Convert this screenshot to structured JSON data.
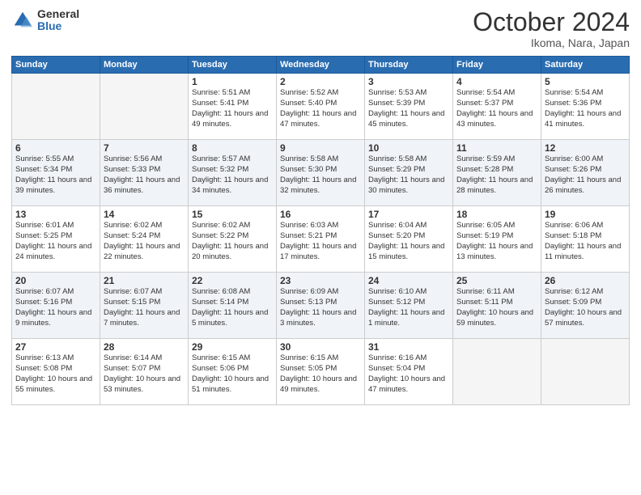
{
  "logo": {
    "general": "General",
    "blue": "Blue"
  },
  "title": "October 2024",
  "location": "Ikoma, Nara, Japan",
  "days_of_week": [
    "Sunday",
    "Monday",
    "Tuesday",
    "Wednesday",
    "Thursday",
    "Friday",
    "Saturday"
  ],
  "weeks": [
    [
      {
        "day": "",
        "info": ""
      },
      {
        "day": "",
        "info": ""
      },
      {
        "day": "1",
        "info": "Sunrise: 5:51 AM\nSunset: 5:41 PM\nDaylight: 11 hours and 49 minutes."
      },
      {
        "day": "2",
        "info": "Sunrise: 5:52 AM\nSunset: 5:40 PM\nDaylight: 11 hours and 47 minutes."
      },
      {
        "day": "3",
        "info": "Sunrise: 5:53 AM\nSunset: 5:39 PM\nDaylight: 11 hours and 45 minutes."
      },
      {
        "day": "4",
        "info": "Sunrise: 5:54 AM\nSunset: 5:37 PM\nDaylight: 11 hours and 43 minutes."
      },
      {
        "day": "5",
        "info": "Sunrise: 5:54 AM\nSunset: 5:36 PM\nDaylight: 11 hours and 41 minutes."
      }
    ],
    [
      {
        "day": "6",
        "info": "Sunrise: 5:55 AM\nSunset: 5:34 PM\nDaylight: 11 hours and 39 minutes."
      },
      {
        "day": "7",
        "info": "Sunrise: 5:56 AM\nSunset: 5:33 PM\nDaylight: 11 hours and 36 minutes."
      },
      {
        "day": "8",
        "info": "Sunrise: 5:57 AM\nSunset: 5:32 PM\nDaylight: 11 hours and 34 minutes."
      },
      {
        "day": "9",
        "info": "Sunrise: 5:58 AM\nSunset: 5:30 PM\nDaylight: 11 hours and 32 minutes."
      },
      {
        "day": "10",
        "info": "Sunrise: 5:58 AM\nSunset: 5:29 PM\nDaylight: 11 hours and 30 minutes."
      },
      {
        "day": "11",
        "info": "Sunrise: 5:59 AM\nSunset: 5:28 PM\nDaylight: 11 hours and 28 minutes."
      },
      {
        "day": "12",
        "info": "Sunrise: 6:00 AM\nSunset: 5:26 PM\nDaylight: 11 hours and 26 minutes."
      }
    ],
    [
      {
        "day": "13",
        "info": "Sunrise: 6:01 AM\nSunset: 5:25 PM\nDaylight: 11 hours and 24 minutes."
      },
      {
        "day": "14",
        "info": "Sunrise: 6:02 AM\nSunset: 5:24 PM\nDaylight: 11 hours and 22 minutes."
      },
      {
        "day": "15",
        "info": "Sunrise: 6:02 AM\nSunset: 5:22 PM\nDaylight: 11 hours and 20 minutes."
      },
      {
        "day": "16",
        "info": "Sunrise: 6:03 AM\nSunset: 5:21 PM\nDaylight: 11 hours and 17 minutes."
      },
      {
        "day": "17",
        "info": "Sunrise: 6:04 AM\nSunset: 5:20 PM\nDaylight: 11 hours and 15 minutes."
      },
      {
        "day": "18",
        "info": "Sunrise: 6:05 AM\nSunset: 5:19 PM\nDaylight: 11 hours and 13 minutes."
      },
      {
        "day": "19",
        "info": "Sunrise: 6:06 AM\nSunset: 5:18 PM\nDaylight: 11 hours and 11 minutes."
      }
    ],
    [
      {
        "day": "20",
        "info": "Sunrise: 6:07 AM\nSunset: 5:16 PM\nDaylight: 11 hours and 9 minutes."
      },
      {
        "day": "21",
        "info": "Sunrise: 6:07 AM\nSunset: 5:15 PM\nDaylight: 11 hours and 7 minutes."
      },
      {
        "day": "22",
        "info": "Sunrise: 6:08 AM\nSunset: 5:14 PM\nDaylight: 11 hours and 5 minutes."
      },
      {
        "day": "23",
        "info": "Sunrise: 6:09 AM\nSunset: 5:13 PM\nDaylight: 11 hours and 3 minutes."
      },
      {
        "day": "24",
        "info": "Sunrise: 6:10 AM\nSunset: 5:12 PM\nDaylight: 11 hours and 1 minute."
      },
      {
        "day": "25",
        "info": "Sunrise: 6:11 AM\nSunset: 5:11 PM\nDaylight: 10 hours and 59 minutes."
      },
      {
        "day": "26",
        "info": "Sunrise: 6:12 AM\nSunset: 5:09 PM\nDaylight: 10 hours and 57 minutes."
      }
    ],
    [
      {
        "day": "27",
        "info": "Sunrise: 6:13 AM\nSunset: 5:08 PM\nDaylight: 10 hours and 55 minutes."
      },
      {
        "day": "28",
        "info": "Sunrise: 6:14 AM\nSunset: 5:07 PM\nDaylight: 10 hours and 53 minutes."
      },
      {
        "day": "29",
        "info": "Sunrise: 6:15 AM\nSunset: 5:06 PM\nDaylight: 10 hours and 51 minutes."
      },
      {
        "day": "30",
        "info": "Sunrise: 6:15 AM\nSunset: 5:05 PM\nDaylight: 10 hours and 49 minutes."
      },
      {
        "day": "31",
        "info": "Sunrise: 6:16 AM\nSunset: 5:04 PM\nDaylight: 10 hours and 47 minutes."
      },
      {
        "day": "",
        "info": ""
      },
      {
        "day": "",
        "info": ""
      }
    ]
  ]
}
